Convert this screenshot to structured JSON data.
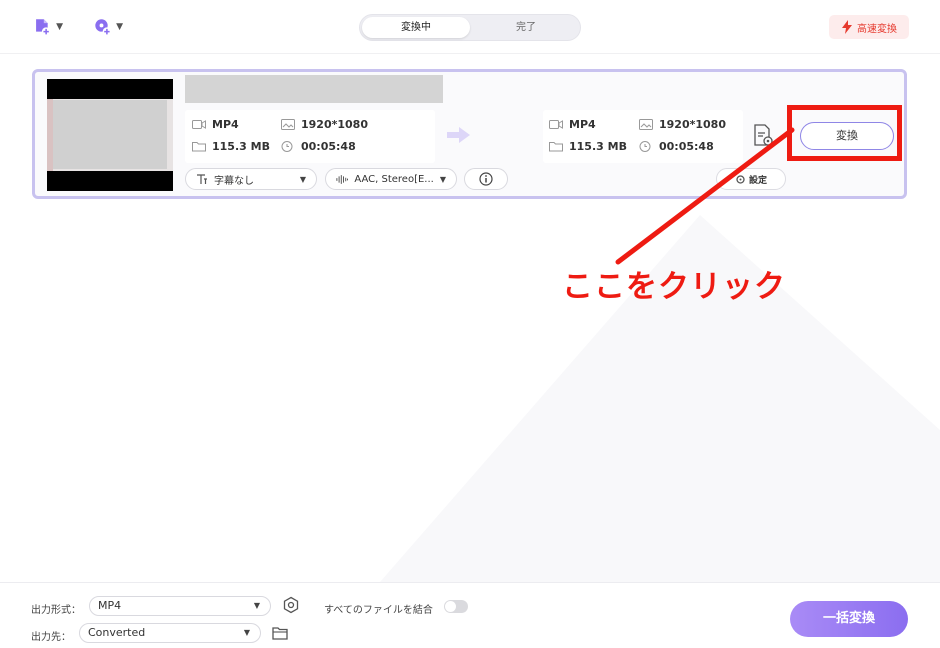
{
  "toolbar": {
    "add_file_icon": "add-file-icon",
    "add_dvd_icon": "add-dvd-icon",
    "tabs": [
      {
        "label": "変換中",
        "active": true
      },
      {
        "label": "完了",
        "active": false
      }
    ],
    "fast_convert_label": "高速変換"
  },
  "file": {
    "source": {
      "format": "MP4",
      "resolution": "1920*1080",
      "size": "115.3 MB",
      "duration": "00:05:48"
    },
    "target": {
      "format": "MP4",
      "resolution": "1920*1080",
      "size": "115.3 MB",
      "duration": "00:05:48"
    },
    "subtitle_label": "字幕なし",
    "audio_label": "AAC, Stereo[E...",
    "convert_label": "変換",
    "settings_label": "設定"
  },
  "annotation": {
    "text": "ここをクリック",
    "color": "#ee1b12"
  },
  "bottom": {
    "output_format_label": "出力形式：",
    "output_format_value": "MP4",
    "merge_label": "すべてのファイルを結合",
    "merge_enabled": false,
    "output_dest_label": "出力先：",
    "output_dest_value": "Converted",
    "batch_convert_label": "一括変換"
  },
  "colors": {
    "accent": "#8b6ef0",
    "card_border": "#c8c2ef",
    "fast_convert": "#e63a2e"
  }
}
